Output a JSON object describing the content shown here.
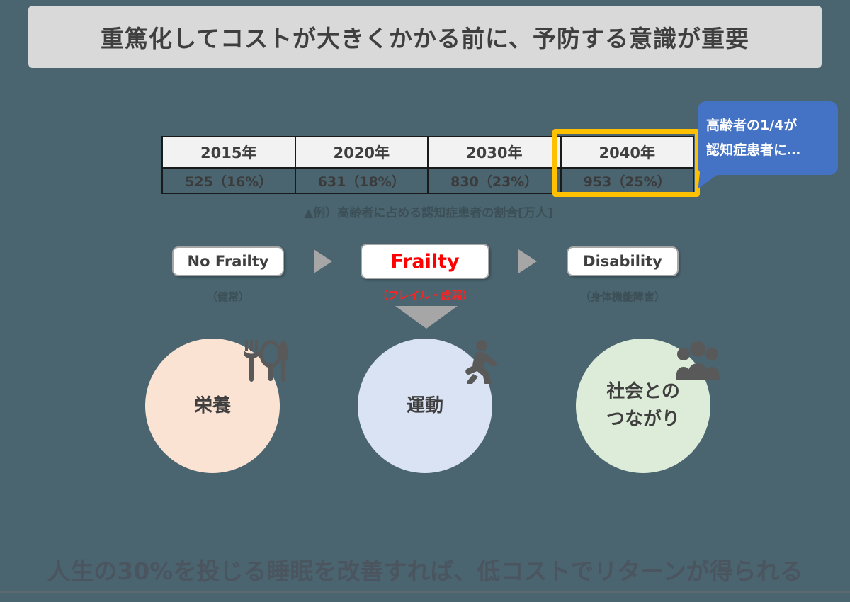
{
  "header": {
    "title": "重篤化してコストが大きくかかる前に、予防する意識が重要"
  },
  "forecast_table": {
    "years": [
      "2015年",
      "2020年",
      "2030年",
      "2040年"
    ],
    "values": [
      "525（16%）",
      "631（18%）",
      "830（23%）",
      "953（25%）"
    ],
    "highlighted_column_label": "2040年",
    "highlight_color": "#ffc000",
    "caption": "▲例）高齢者に占める認知症患者の割合[万人]"
  },
  "callout": {
    "line1": "高齢者の1/4が",
    "line2": "認知症患者に…",
    "color": "#4472c4"
  },
  "stages": [
    {
      "label": "No Frailty",
      "sub": "（健常）",
      "accent": false
    },
    {
      "label": "Frailty",
      "sub": "（フレイル・虚弱）",
      "accent": true
    },
    {
      "label": "Disability",
      "sub": "（身体機能障害）",
      "accent": false
    }
  ],
  "arrows": {
    "stage_arrow_icon": "triangle-right-icon",
    "down_arrow_icon": "triangle-down-icon",
    "color": "#a6a6a6"
  },
  "pillars": [
    {
      "label_line1": "栄養",
      "label_line2": "",
      "icon": "cutlery-icon",
      "color": "#fbe3d4"
    },
    {
      "label_line1": "運動",
      "label_line2": "",
      "icon": "running-person-icon",
      "color": "#dae3f3"
    },
    {
      "label_line1": "社会との",
      "label_line2": "つながり",
      "icon": "people-group-icon",
      "color": "#ddecd8"
    }
  ],
  "footer": {
    "statement": "人生の30%を投じる睡眠を改善すれば、低コストでリターンが得られる"
  }
}
